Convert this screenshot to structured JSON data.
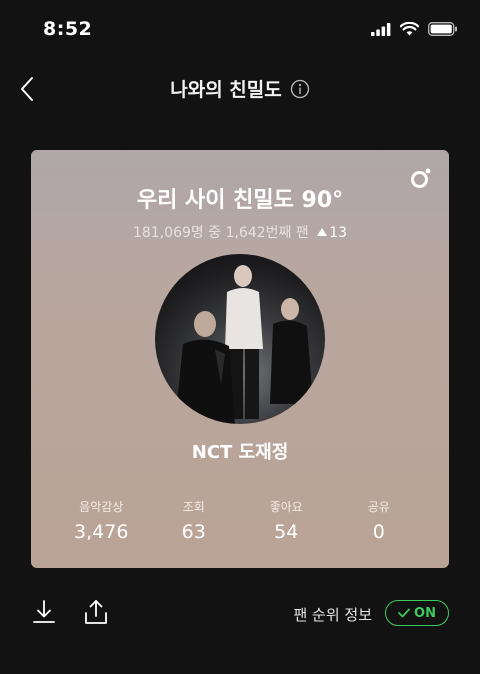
{
  "status_bar": {
    "time": "8:52"
  },
  "nav": {
    "title": "나와의 친밀도"
  },
  "card": {
    "headline": "우리 사이 친밀도 90°",
    "rank": {
      "total": "181,069명",
      "middle": "중",
      "position": "1,642번째 팬",
      "change": "13"
    },
    "artist_name": "NCT 도재정",
    "stats": [
      {
        "label": "음악감상",
        "value": "3,476"
      },
      {
        "label": "조회",
        "value": "63"
      },
      {
        "label": "좋아요",
        "value": "54"
      },
      {
        "label": "공유",
        "value": "0"
      }
    ]
  },
  "bottom": {
    "fan_rank_label": "팬 순위 정보",
    "toggle_label": "ON"
  },
  "colors": {
    "accent_green": "#3fc85f",
    "background": "#121212"
  }
}
